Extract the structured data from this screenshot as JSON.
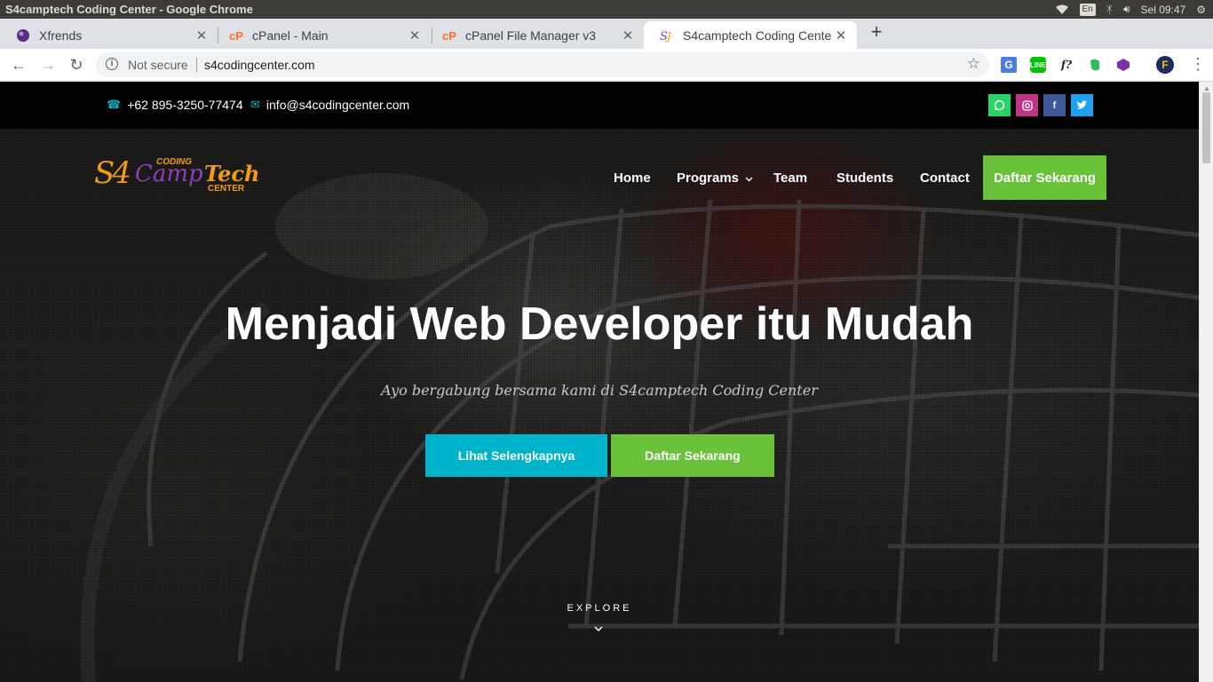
{
  "os": {
    "window_title": "S4camptech Coding Center - Google Chrome",
    "lang": "En",
    "clock": "Sel 09:47"
  },
  "tabs": [
    {
      "label": "Xfrends",
      "icon": "xfrends-favicon"
    },
    {
      "label": "cPanel - Main",
      "icon": "cpanel-favicon"
    },
    {
      "label": "cPanel File Manager v3",
      "icon": "cpanel-favicon"
    },
    {
      "label": "S4camptech Coding Cente",
      "icon": "s4-favicon",
      "active": true
    }
  ],
  "omnibox": {
    "security": "Not secure",
    "url": "s4codingcenter.com"
  },
  "extensions": [
    "google-translate-icon",
    "line-icon",
    "formula-icon",
    "evernote-icon",
    "cube-icon",
    "profile-avatar"
  ],
  "topbar": {
    "phone": "+62 895-3250-77474",
    "email": "info@s4codingcenter.com",
    "socials": [
      {
        "name": "whatsapp",
        "color": "#25d366"
      },
      {
        "name": "instagram",
        "color": "#c13584"
      },
      {
        "name": "facebook",
        "color": "#3b5998"
      },
      {
        "name": "twitter",
        "color": "#1da1f2"
      }
    ]
  },
  "logo": {
    "mark": "S4",
    "coding": "CODING",
    "camp": "Camp",
    "tech": "Tech",
    "center": "CENTER"
  },
  "nav": {
    "home": "Home",
    "programs": "Programs",
    "team": "Team",
    "students": "Students",
    "contact": "Contact",
    "cta": "Daftar Sekarang"
  },
  "hero": {
    "title": "Menjadi Web Developer itu Mudah",
    "subtitle": "Ayo bergabung bersama kami di S4camptech Coding Center",
    "primary_button": "Lihat Selengkapnya",
    "secondary_button": "Daftar Sekarang",
    "explore": "EXPLORE"
  },
  "colors": {
    "accent_cyan": "#00b4cc",
    "accent_green": "#6ac13a",
    "logo_orange": "#f39c12",
    "logo_purple": "#8e3fb7"
  }
}
